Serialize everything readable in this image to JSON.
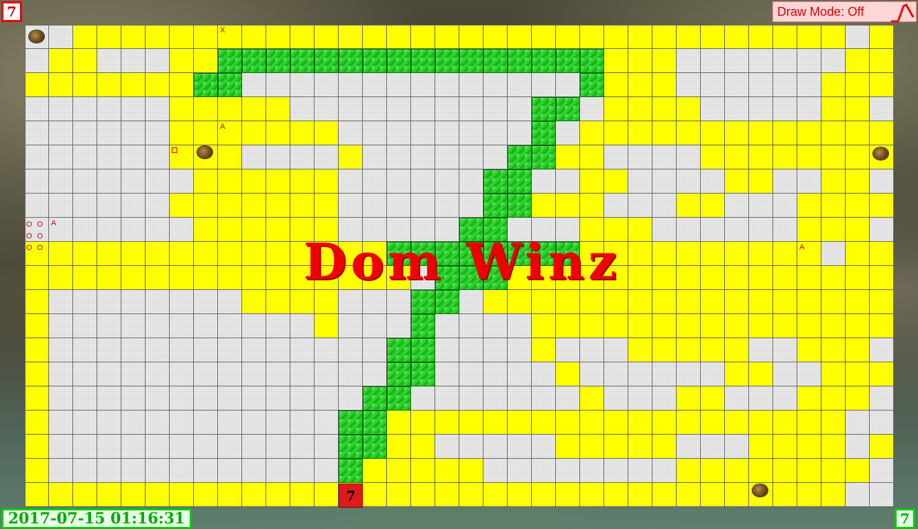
{
  "corner_top_left": "7",
  "corner_bottom_right": "7",
  "draw_mode_label": "Draw Mode: Off",
  "title": "Dom Winz",
  "timestamp": "2017-07-15 01:16:31",
  "goal_tile_label": "7",
  "markers": {
    "x_marker": "X",
    "a_marker_1": "A",
    "a_marker_2": "A",
    "a_marker_3": "A",
    "o_cluster": "O O O O O O"
  },
  "colors": {
    "path": "#ffff00",
    "open": "#ebebeb",
    "snake": "#2ad62a",
    "accent": "#e00000",
    "status_green": "#00aa00"
  },
  "icons": [
    "pencil-curve-icon",
    "coin-icon",
    "square-marker-icon"
  ],
  "grid": {
    "cols": 36,
    "rows": 20,
    "rows_map": [
      "wwyyyyyyyyyyyyyyyyyyyyyyyyyyyyyyyywy",
      "wyywwwyyggggggggggggggggyyywwwwwwwyy",
      "yyyyyyyggwwwwwwwwwwwwwwgyyywwwwwwyyy",
      "wwwwwwyyyyywwwwwwwwwwggwyyyywwwwwyyw",
      "wwwwwwyyyyyyywwwwwwwwgwyyyyyyyyyyyyy",
      "wwwwwwyyywwwwywwwwwwggyywwwwyyyyyyyy",
      "wwwwwwwyyyyyywwwwwwggwwyywwwwyywwyyw",
      "wwwwwwyyyyyyywwwwwwggyyywwwyywwwyyyy",
      "wwwwwwwyyyyyywwwwwggwwwyyywwwwwwyyyw",
      "yyyyyyyyyyyyyyyggggggggyyyyyyyyyywyy",
      "yyyyyyyyyyyyyyyywgggyyyyyyyyyyyyyyyy",
      "ywwwwwwwwyyyywwwggwyyyyyyyyyyyyyyyyy",
      "ywwwwwwwwwwwywwwgwwwwyyyyyyyyyyyyyyy",
      "ywwwwwwwwwwwwwwggwwwwywwwyyyyywwyyyw",
      "ywwwwwwwwwwwwwwggwwwwwywwwwwwyywwyyy",
      "ywwwwwwwwwwwwwggwwwwwwwywwwyywwwyyyw",
      "ywwwwwwwwwwwwggyyyyyyyyyyyyyyyyyyyww",
      "ywwwwwwwwwwwwggyywwwwwyyyyywwwyyyywy",
      "ywwwwwwwwwwwwgyyyyywwwwwwwwyyyyyyyyw",
      "yyyyyyyyyyyyyyyyyyyyyyyyyyyyyyyyyyww"
    ]
  }
}
